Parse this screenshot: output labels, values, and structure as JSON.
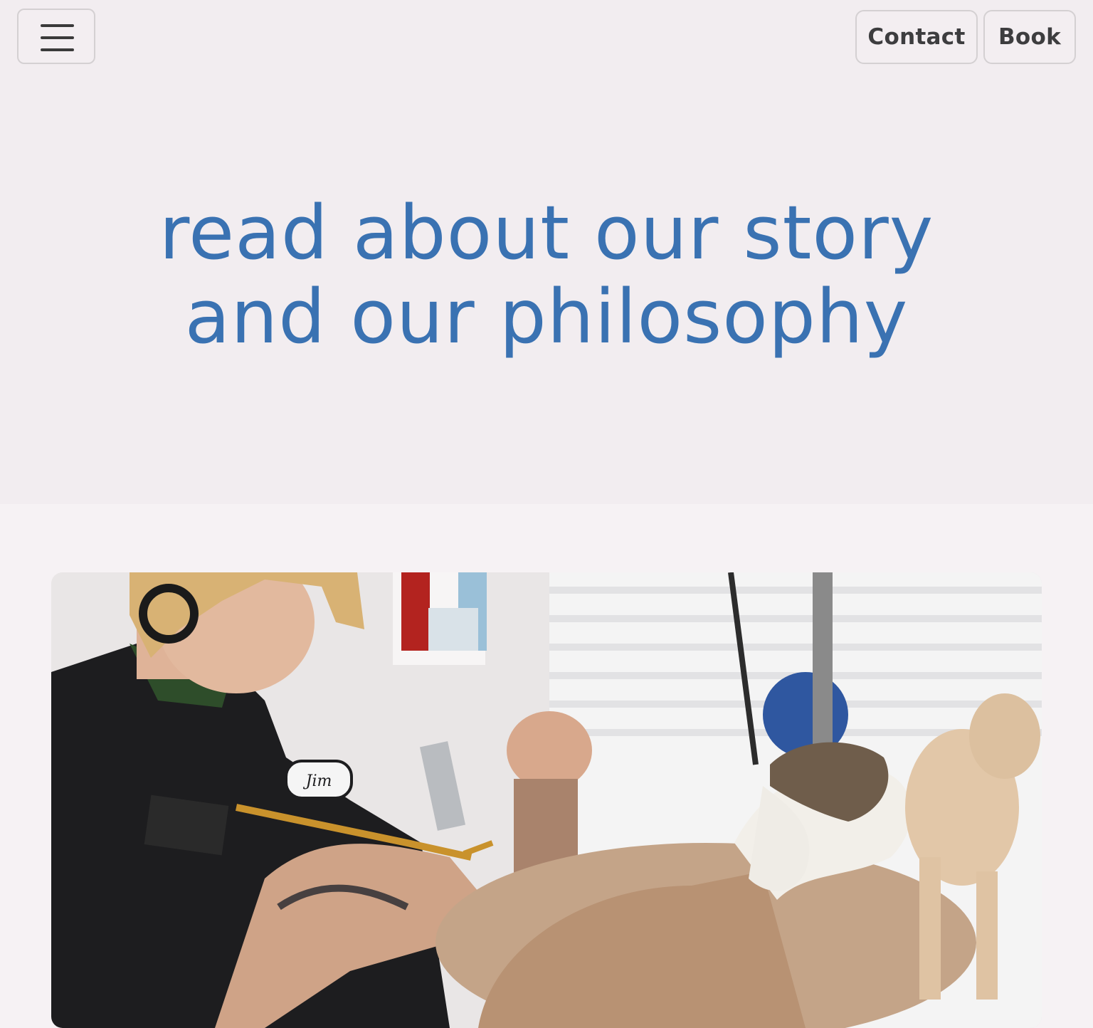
{
  "header": {
    "menu_icon": "hamburger-menu-icon",
    "contact_label": "Contact",
    "book_label": "Book"
  },
  "hero": {
    "title_line1": "read about our story",
    "title_line2": "and our philosophy"
  },
  "colors": {
    "accent": "#3a72b2",
    "hero_background": "#f2edf0",
    "page_background": "#f6f2f4",
    "button_text": "#3d3d3f"
  },
  "photo": {
    "name_patch_text": "Jim"
  }
}
